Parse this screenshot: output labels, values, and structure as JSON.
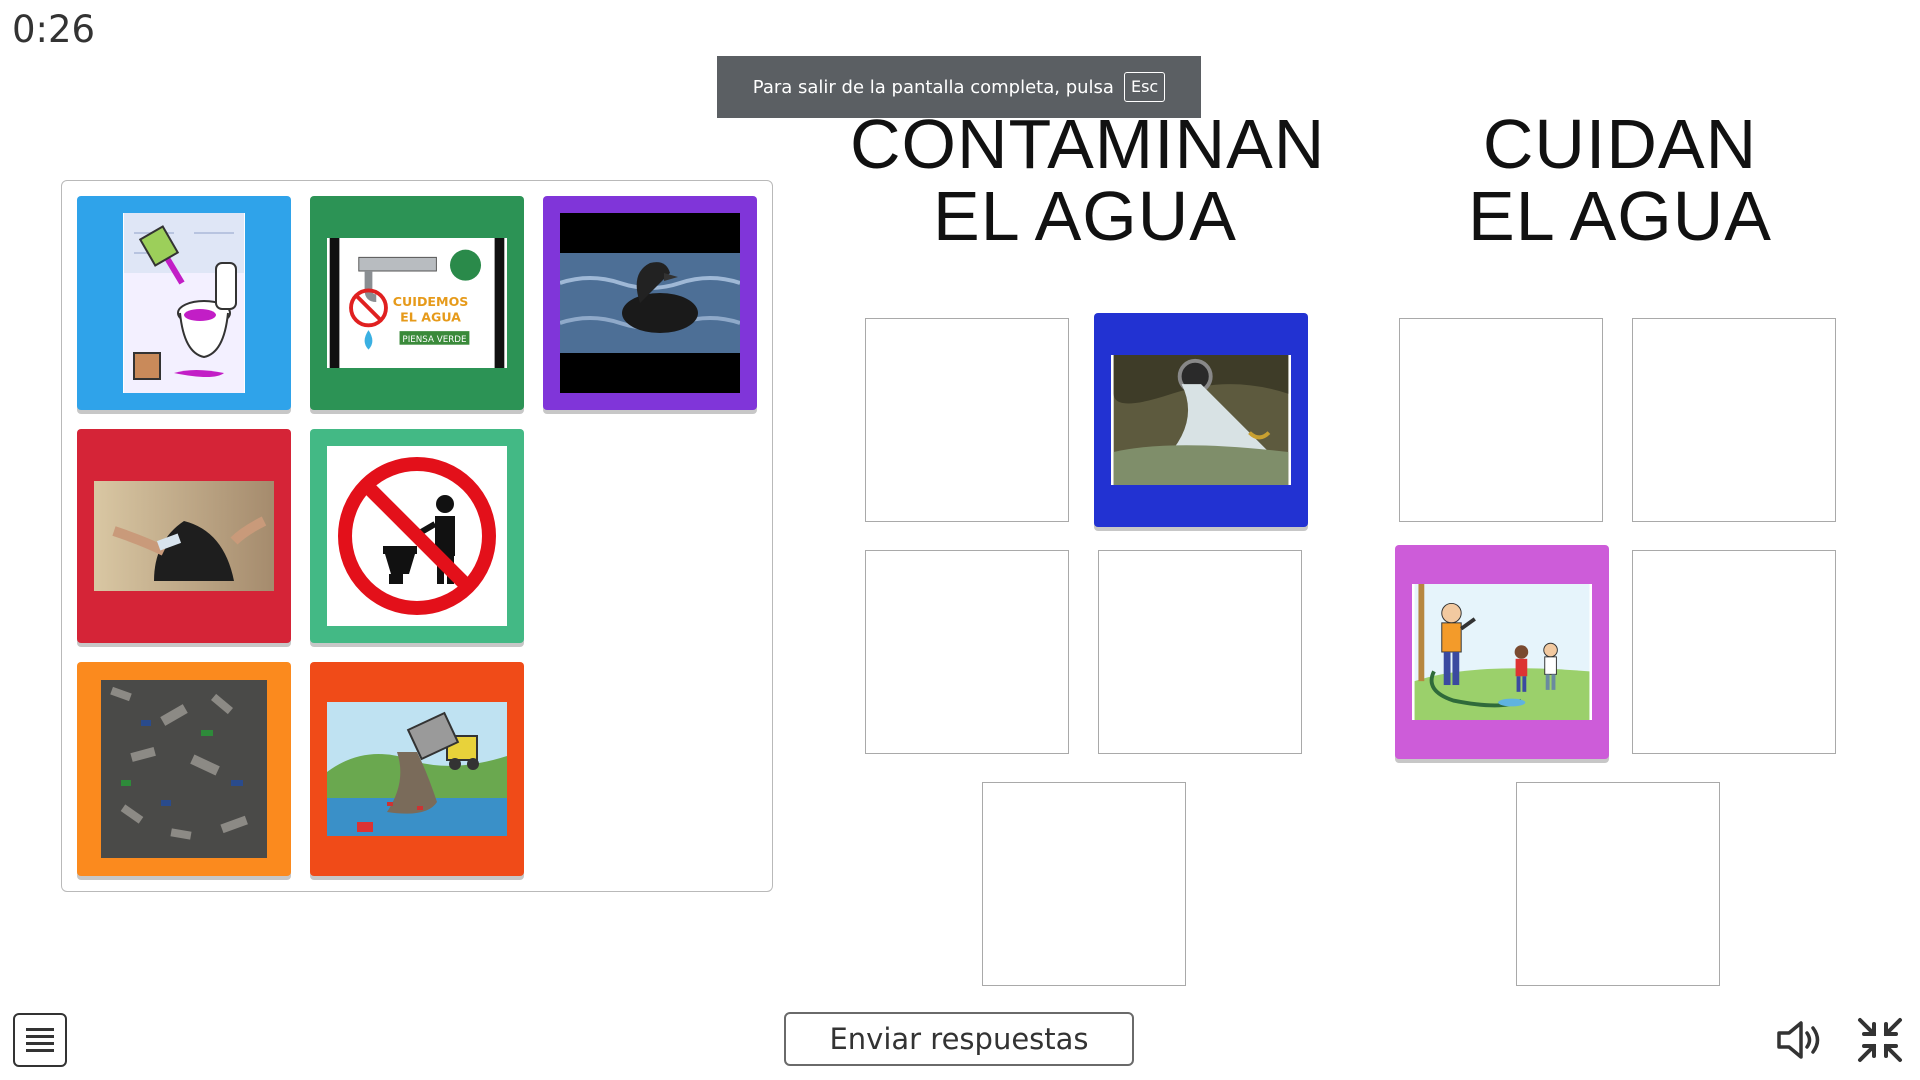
{
  "timer": "0:26",
  "fullscreen_notice": {
    "text": "Para salir de la pantalla completa, pulsa",
    "key": "Esc"
  },
  "categories": [
    {
      "title_line1": "CONTAMINAN",
      "title_line2": "EL AGUA"
    },
    {
      "title_line1": "CUIDAN",
      "title_line2": "EL AGUA"
    }
  ],
  "source_tiles": [
    {
      "name": "tile-pouring-paint-toilet",
      "color": "#2fa3ea"
    },
    {
      "name": "tile-cuidemos-el-agua",
      "color": "#2c9355",
      "caption_1": "CUIDEMOS",
      "caption_2": "EL AGUA",
      "caption_3": "PIENSA VERDE"
    },
    {
      "name": "tile-oil-covered-bird",
      "color": "#8035d9"
    },
    {
      "name": "tile-trash-bag-cleanup",
      "color": "#d52437"
    },
    {
      "name": "tile-no-littering-sign",
      "color": "#43b985"
    },
    {
      "name": "tile-garbage-pile",
      "color": "#fb8a1e"
    },
    {
      "name": "tile-truck-dumping-garbage",
      "color": "#f04b18"
    }
  ],
  "placed_tiles": [
    {
      "name": "tile-sewage-pipe",
      "color": "#2232d2",
      "category": "CONTAMINAN EL AGUA"
    },
    {
      "name": "tile-boy-with-hose",
      "color": "#cd5cd9",
      "category": "CUIDAN EL AGUA"
    }
  ],
  "submit_label": "Enviar respuestas",
  "icons": {
    "menu": "menu-icon",
    "sound": "speaker-icon",
    "exit_fullscreen": "exit-fullscreen-icon"
  }
}
